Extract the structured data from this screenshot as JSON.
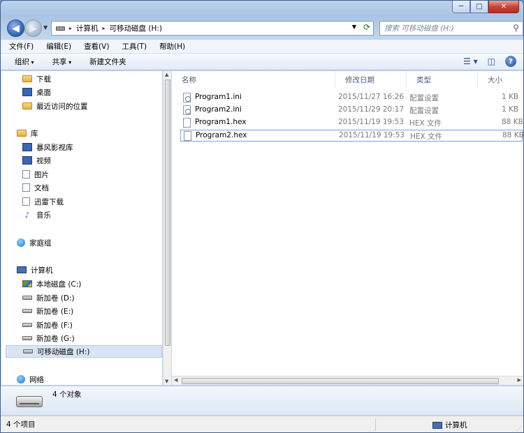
{
  "window": {
    "caption": {
      "minimize": "─",
      "maximize": "□",
      "close": "✕"
    }
  },
  "address_bar": {
    "segments": [
      "计算机",
      "可移动磁盘 (H:)"
    ],
    "separator": "▸"
  },
  "search": {
    "placeholder": "搜索 可移动磁盘 (H:)"
  },
  "menu": [
    "文件(F)",
    "编辑(E)",
    "查看(V)",
    "工具(T)",
    "帮助(H)"
  ],
  "toolbar": {
    "organize": "组织",
    "share": "共享",
    "new_folder": "新建文件夹"
  },
  "nav_pane": {
    "items": [
      {
        "label": "下载",
        "icon": "download-folder-icon"
      },
      {
        "label": "桌面",
        "icon": "desktop-icon"
      },
      {
        "label": "最近访问的位置",
        "icon": "recent-places-icon"
      },
      {
        "label": "库",
        "icon": "library-icon"
      },
      {
        "label": "暴风影视库",
        "icon": "video-library-icon"
      },
      {
        "label": "视频",
        "icon": "videos-icon"
      },
      {
        "label": "图片",
        "icon": "pictures-icon"
      },
      {
        "label": "文档",
        "icon": "documents-icon"
      },
      {
        "label": "迅雷下载",
        "icon": "thunder-download-icon"
      },
      {
        "label": "音乐",
        "icon": "music-icon"
      },
      {
        "label": "家庭组",
        "icon": "homegroup-icon"
      },
      {
        "label": "计算机",
        "icon": "computer-icon"
      },
      {
        "label": "本地磁盘 (C:)",
        "icon": "local-disk-icon"
      },
      {
        "label": "新加卷 (D:)",
        "icon": "drive-icon"
      },
      {
        "label": "新加卷 (E:)",
        "icon": "drive-icon"
      },
      {
        "label": "新加卷 (F:)",
        "icon": "drive-icon"
      },
      {
        "label": "新加卷 (G:)",
        "icon": "drive-icon"
      },
      {
        "label": "可移动磁盘 (H:)",
        "icon": "removable-disk-icon",
        "selected": true
      },
      {
        "label": "网络",
        "icon": "network-icon"
      }
    ]
  },
  "file_list": {
    "columns": [
      "名称",
      "修改日期",
      "类型",
      "大小"
    ],
    "rows": [
      {
        "name": "Program1.ini",
        "date": "2015/11/27 16:26",
        "type": "配置设置",
        "size": "1 KB"
      },
      {
        "name": "Program2.ini",
        "date": "2015/11/29 20:17",
        "type": "配置设置",
        "size": "1 KB"
      },
      {
        "name": "Program1.hex",
        "date": "2015/11/19 19:53",
        "type": "HEX 文件",
        "size": "88 KB"
      },
      {
        "name": "Program2.hex",
        "date": "2015/11/19 19:53",
        "type": "HEX 文件",
        "size": "88 KB"
      }
    ]
  },
  "details_pane": {
    "count_text": "4 个对象"
  },
  "status_bar": {
    "items_text": "4 个项目",
    "location": "计算机"
  }
}
